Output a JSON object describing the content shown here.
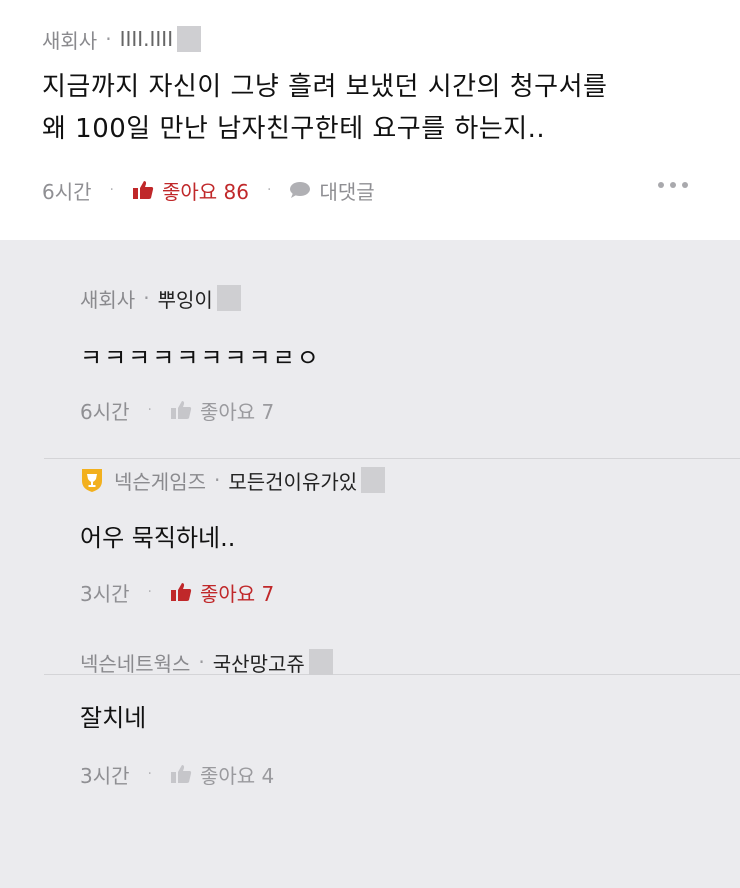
{
  "post": {
    "company": "새회사",
    "nickname": "IIII.IIII",
    "text_line1": "지금까지 자신이 그냥 흘려 보냈던 시간의 청구서를",
    "text_line2": "왜 100일 만난 남자친구한테 요구를 하는지..",
    "time": "6시간",
    "like_label": "좋아요 86",
    "reply_label": "대댓글"
  },
  "replies": [
    {
      "company": "새회사",
      "nickname": "뿌잉이",
      "text": "ㅋㅋㅋㅋㅋㅋㅋㅋㄹㅇ",
      "time": "6시간",
      "like_label": "좋아요 7",
      "liked": false
    },
    {
      "company": "넥슨게임즈",
      "nickname": "모든건이유가있",
      "text": "어우 묵직하네..",
      "time": "3시간",
      "like_label": "좋아요 7",
      "liked": true,
      "badge_icon": "trophy-badge-icon"
    },
    {
      "company": "넥슨네트웍스",
      "nickname": "국산망고쥬",
      "text": "잘치네",
      "time": "3시간",
      "like_label": "좋아요 4",
      "liked": false
    }
  ],
  "colors": {
    "like_active": "#c0282a",
    "like_inactive": "#b9b9bd",
    "badge": "#f2b01e"
  }
}
